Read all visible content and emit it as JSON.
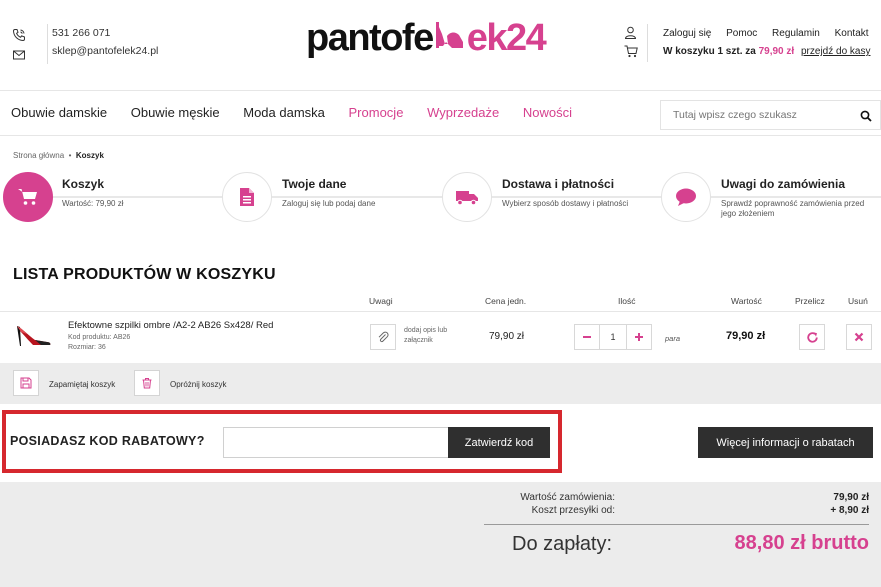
{
  "header": {
    "phone": "531 266 071",
    "email": "sklep@pantofelek24.pl",
    "logo": {
      "part1": "pantofe",
      "part2": "ek24"
    },
    "links": [
      "Zaloguj się",
      "Pomoc",
      "Regulamin",
      "Kontakt"
    ],
    "cart": {
      "prefix": "W koszyku 1 szt. za",
      "amount": "79,90 zł",
      "go_link": "przejdź do kasy"
    }
  },
  "nav": {
    "items": [
      "Obuwie damskie",
      "Obuwie męskie",
      "Moda damska",
      "Promocje",
      "Wyprzedaże",
      "Nowości"
    ],
    "search_placeholder": "Tutaj wpisz czego szukasz"
  },
  "breadcrumb": {
    "home": "Strona główna",
    "sep": "•",
    "current": "Koszyk"
  },
  "steps": [
    {
      "title": "Koszyk",
      "subtitle": "Wartość: 79,90 zł",
      "icon": "cart-icon"
    },
    {
      "title": "Twoje dane",
      "subtitle": "Zaloguj się lub podaj dane",
      "icon": "document-icon"
    },
    {
      "title": "Dostawa i płatności",
      "subtitle": "Wybierz sposób dostawy i płatności",
      "icon": "truck-icon"
    },
    {
      "title": "Uwagi do zamówienia",
      "subtitle": "Sprawdź poprawność zamówienia przed jego złożeniem",
      "icon": "speech-bubble-icon"
    }
  ],
  "cart_list": {
    "title": "LISTA PRODUKTÓW W KOSZYKU",
    "columns": [
      "Uwagi",
      "Cena jedn.",
      "Ilość",
      "Wartość",
      "Przelicz",
      "Usuń"
    ],
    "items": [
      {
        "name": "Efektowne szpilki ombre /A2-2 AB26 Sx428/ Red",
        "code": "Kod produktu: AB26",
        "size": "Rozmiar: 36",
        "note_label": "dodaj opis lub załącznik",
        "unit_price": "79,90 zł",
        "quantity": "1",
        "unit": "para",
        "total": "79,90 zł"
      }
    ],
    "actions": {
      "save": "Zapamiętaj koszyk",
      "empty": "Opróżnij koszyk"
    }
  },
  "coupon": {
    "label": "POSIADASZ KOD RABATOWY?",
    "input_value": "",
    "submit": "Zatwierdź kod",
    "more_info": "Więcej informacji o rabatach"
  },
  "summary": {
    "order_value_label": "Wartość zamówienia:",
    "order_value": "79,90 zł",
    "shipping_label": "Koszt przesyłki od:",
    "shipping": "+ 8,90 zł",
    "to_pay_label": "Do zapłaty:",
    "to_pay": "88,80 zł brutto"
  },
  "colors": {
    "brand_pink": "#d6418f",
    "highlight_red": "#d6282e",
    "dark_button": "#2f2f2f"
  }
}
